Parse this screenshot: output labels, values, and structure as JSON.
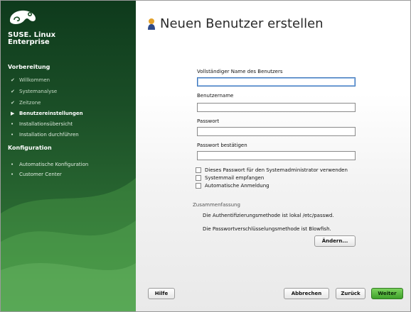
{
  "brand": {
    "line1": "SUSE. Linux",
    "line2": "Enterprise"
  },
  "sidebar": {
    "sections": [
      {
        "title": "Vorbereitung"
      },
      {
        "title": "Konfiguration"
      }
    ],
    "prep_steps": [
      {
        "label": "Willkommen",
        "state": "done"
      },
      {
        "label": "Systemanalyse",
        "state": "done"
      },
      {
        "label": "Zeitzone",
        "state": "done"
      },
      {
        "label": "Benutzereinstellungen",
        "state": "active"
      },
      {
        "label": "Installationsübersicht",
        "state": "todo"
      },
      {
        "label": "Installation durchführen",
        "state": "todo"
      }
    ],
    "config_steps": [
      {
        "label": "Automatische Konfiguration",
        "state": "todo"
      },
      {
        "label": "Customer Center",
        "state": "todo"
      }
    ],
    "marks": {
      "done": "✔",
      "active": "▶",
      "todo": "•"
    }
  },
  "main": {
    "title": "Neuen Benutzer erstellen",
    "fields": {
      "fullname_label": "Vollständiger Name des Benutzers",
      "fullname_value": "",
      "username_label": "Benutzername",
      "username_value": "",
      "password_label": "Passwort",
      "password_value": "",
      "confirm_label": "Passwort bestätigen",
      "confirm_value": ""
    },
    "checkboxes": {
      "admin_label": "Dieses Passwort für den Systemadministrator verwenden",
      "mail_label": "Systemmail empfangen",
      "autologin_label": "Automatische Anmeldung"
    },
    "summary": {
      "title": "Zusammenfassung",
      "line1": "Die Authentifizierungsmethode ist lokal /etc/passwd.",
      "line2": "Die Passwortverschlüsselungsmethode ist Blowfish.",
      "change_button": "Ändern..."
    }
  },
  "footer": {
    "help": "Hilfe",
    "cancel": "Abbrechen",
    "back": "Zurück",
    "next": "Weiter"
  },
  "colors": {
    "sidebar_dark": "#0e3a1c",
    "sidebar_light": "#3a8a3c",
    "accent_green": "#3ea12a"
  }
}
